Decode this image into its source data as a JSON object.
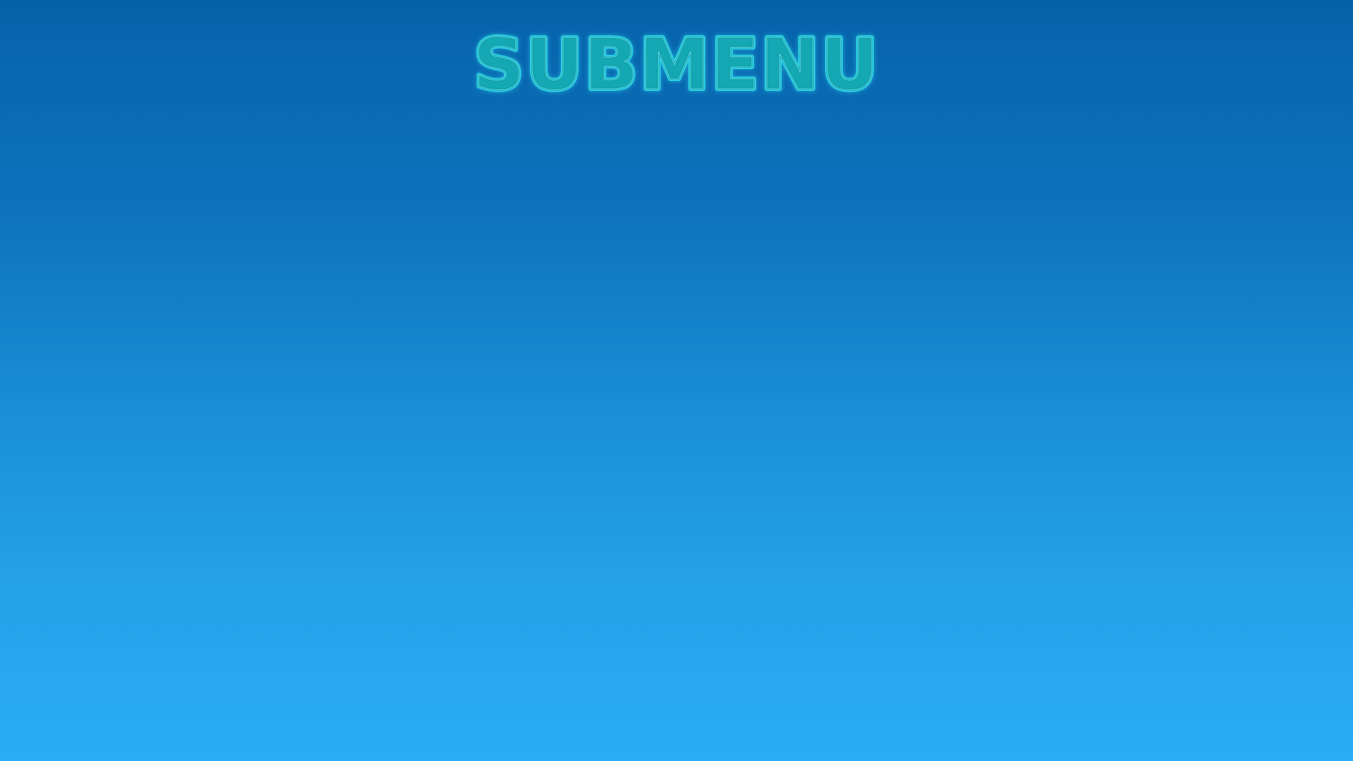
{
  "screen": {
    "title": "SUBMENU"
  },
  "colors": {
    "background_top": "#0562a9",
    "background_bottom": "#2aadf6",
    "title_fill": "#13a8b3",
    "title_outline": "#2fd9ec"
  }
}
